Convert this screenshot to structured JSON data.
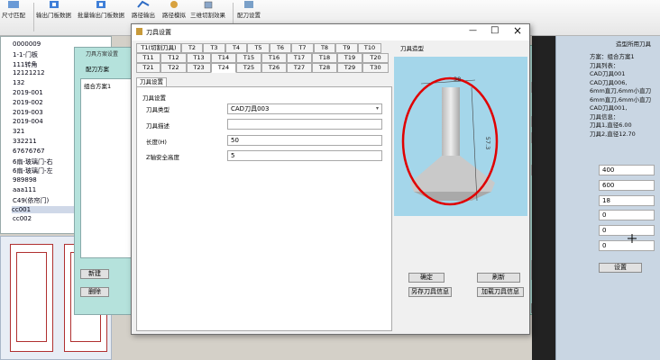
{
  "toolbar": {
    "buttons": [
      {
        "label": "尺寸匹配"
      },
      {
        "label": "输出门板数据"
      },
      {
        "label": "批量输出门板数据"
      },
      {
        "label": "路径输出"
      },
      {
        "label": "路径模拟"
      },
      {
        "label": "三维切割效果"
      },
      {
        "label": "配刀设置"
      }
    ]
  },
  "left_list": {
    "items": [
      "0000009",
      "1-1-门板",
      "111转角",
      "12121212",
      "132",
      "2019-001",
      "2019-002",
      "2019-003",
      "2019-004",
      "321",
      "332211",
      "67676767",
      "6扇-玻璃门-右",
      "6扇-玻璃门-左",
      "989898",
      "aaa111",
      "C49(依帘门)",
      "cc001",
      "cc002"
    ],
    "selected": "cc001"
  },
  "scheme_window": {
    "title": "刀具方案设置",
    "scheme_label": "配刀方案",
    "scheme_item": "组合方案1",
    "buttons": {
      "add": "新建",
      "delete": "删除"
    }
  },
  "right_panel": {
    "header": "造型所用刀具",
    "lines": [
      "方案：组合方案1",
      "刀具列表：",
      "CAD刀具001",
      "CAD刀具006,",
      "6mm直刀,6mm小直刀",
      "6mm直刀,6mm小直刀",
      "CAD刀具001,",
      "刀具信息：",
      "刀具1,直径6.00",
      "刀具2,直径12.70"
    ],
    "values": [
      "400",
      "600",
      "18",
      "0",
      "0",
      "0"
    ],
    "button": "设置"
  },
  "tool_dialog": {
    "title": "刀具设置",
    "tabs_row1": [
      "T1(切割刀具)",
      "T2",
      "T3",
      "T4",
      "T5",
      "T6",
      "T7",
      "T8",
      "T9",
      "T10"
    ],
    "tabs_row2": [
      "T11",
      "T12",
      "T13",
      "T14",
      "T15",
      "T16",
      "T17",
      "T18",
      "T19",
      "T20"
    ],
    "tabs_row3": [
      "T21",
      "T22",
      "T23",
      "T24",
      "T25",
      "T26",
      "T27",
      "T28",
      "T29",
      "T30"
    ],
    "active_tab": "T24",
    "inner_tab": "刀具设置",
    "group_label": "刀具设置",
    "fields": {
      "type": {
        "label": "刀具类型",
        "value": "CAD刀具003"
      },
      "desc": {
        "label": "刀具描述",
        "value": ""
      },
      "length": {
        "label": "长度(H)",
        "value": "50"
      },
      "zsafe": {
        "label": "Z轴安全高度",
        "value": "5"
      }
    },
    "preview_label": "刀具造型",
    "dimensions": {
      "width": "38",
      "height": "57.3"
    },
    "buttons": {
      "ok": "确定",
      "cancel": "刷新",
      "save": "另存刀具信息",
      "load": "加载刀具信息"
    },
    "window_controls": {
      "minimize": "—",
      "maximize": "□",
      "close": "×"
    }
  }
}
